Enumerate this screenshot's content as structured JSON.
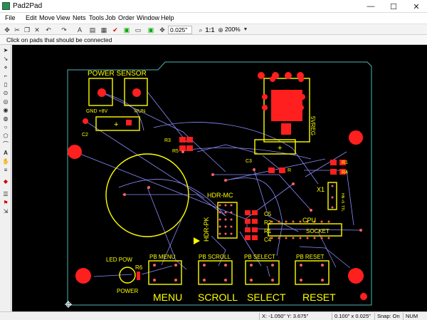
{
  "window": {
    "title": "Pad2Pad"
  },
  "controls": {
    "minimize": "—",
    "maximize": "☐",
    "close": "✕"
  },
  "menu": [
    "File",
    "Edit",
    "Move",
    "View",
    "Nets",
    "Tools",
    "Job",
    "Order",
    "Window",
    "Help"
  ],
  "toolbar": {
    "icons": [
      "move-cursor-icon",
      "cut-icon",
      "copy-icon",
      "delete-icon",
      "undo-icon",
      "redo-icon",
      "text-icon",
      "check-icon",
      "bom-icon",
      "select-icon",
      "order-icon",
      "grid-icon"
    ],
    "grid_value": "0.025\"",
    "zoom_ratio": "1:1",
    "zoom_value": "200%"
  },
  "hint": "Click on pads that should be connected",
  "status": {
    "coords": "X: -1.050\" Y: 3.675\"",
    "grid": "0.100\" x 0.025\"",
    "snap": "Snap: On",
    "num": "NUM"
  },
  "colors": {
    "board_outline": "#4fb3b3",
    "silkscreen": "#ffff00",
    "pads": "#ff1f1f",
    "ratsnest": "#8c8cff",
    "background": "#000000"
  },
  "board": {
    "power_sensor": "POWER  SENSOR",
    "gnd_label": "GND +8V",
    "run_label": "RUN",
    "c2": "C2",
    "plus": "+",
    "r3": "R3",
    "r5": "R5",
    "c3": "C3",
    "vreg": "5VREG",
    "r1": "R1",
    "r4": "R4",
    "rh": "R",
    "x1": "X1",
    "clk": "TTL",
    "clk2": "HN +5",
    "hdr_mc": "HDR-MC",
    "hdr_pk": "HDR-PK",
    "c5": "C5",
    "r2": "R2",
    "r1b": "R1",
    "c4": "C4",
    "cpu": "CPU",
    "socket": "SOCKET",
    "led_pow": "LED POW",
    "r6": "R6",
    "power": "POWER",
    "pb_menu": "PB MENU",
    "pb_scroll": "PB SCROLL",
    "pb_select": "PB SELECT",
    "pb_reset": "PB RESET",
    "menu_big": "MENU",
    "scroll_big": "SCROLL",
    "select_big": "SELECT",
    "reset_big": "RESET"
  }
}
